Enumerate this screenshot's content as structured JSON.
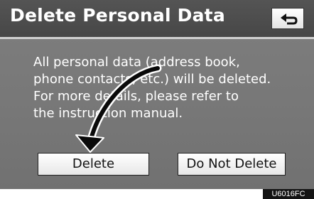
{
  "screen": {
    "title": "Delete Personal Data",
    "message_lines": [
      "All personal data (address book,",
      "phone contacts, etc.) will be deleted.",
      "For more details, please refer to",
      "the instruction manual."
    ],
    "buttons": {
      "delete_label": "Delete",
      "do_not_delete_label": "Do Not Delete"
    },
    "icons": {
      "back": "return-arrow-icon",
      "pointer": "curved-arrow-icon"
    }
  },
  "figure_code": "U6016FC",
  "colors": {
    "title_bar": "#4c4c4c",
    "background": "#7a7a7a",
    "button_face": "#f2f2f2",
    "text": "#ffffff"
  }
}
